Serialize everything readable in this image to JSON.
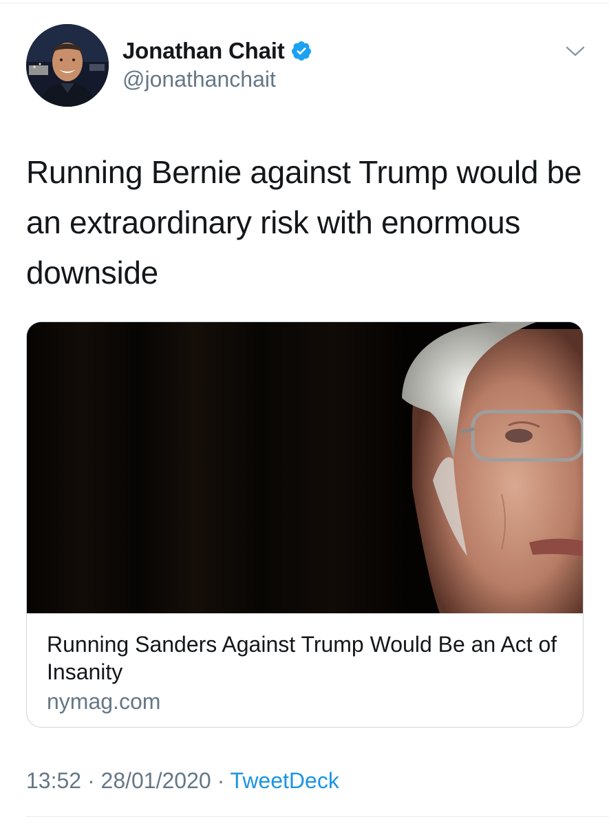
{
  "tweet": {
    "author": {
      "display_name": "Jonathan Chait",
      "handle": "@jonathanchait",
      "verified": true,
      "avatar_icon": "profile-photo",
      "verified_icon": "verified-badge-icon"
    },
    "menu_icon": "chevron-down-icon",
    "text": "Running Bernie against Trump would be an extraordinary risk with enormous downside",
    "link_card": {
      "image_description_icon": "article-photo",
      "title": "Running Sanders Against Trump Would Be an Act of Insanity",
      "domain": "nymag.com"
    },
    "meta": {
      "time": "13:52",
      "separator": " · ",
      "date": "28/01/2020",
      "source": "TweetDeck"
    }
  },
  "colors": {
    "text_primary": "#14171a",
    "text_secondary": "#657786",
    "accent": "#1b95e0",
    "verified": "#1da1f2",
    "border": "#ccd6dd"
  }
}
